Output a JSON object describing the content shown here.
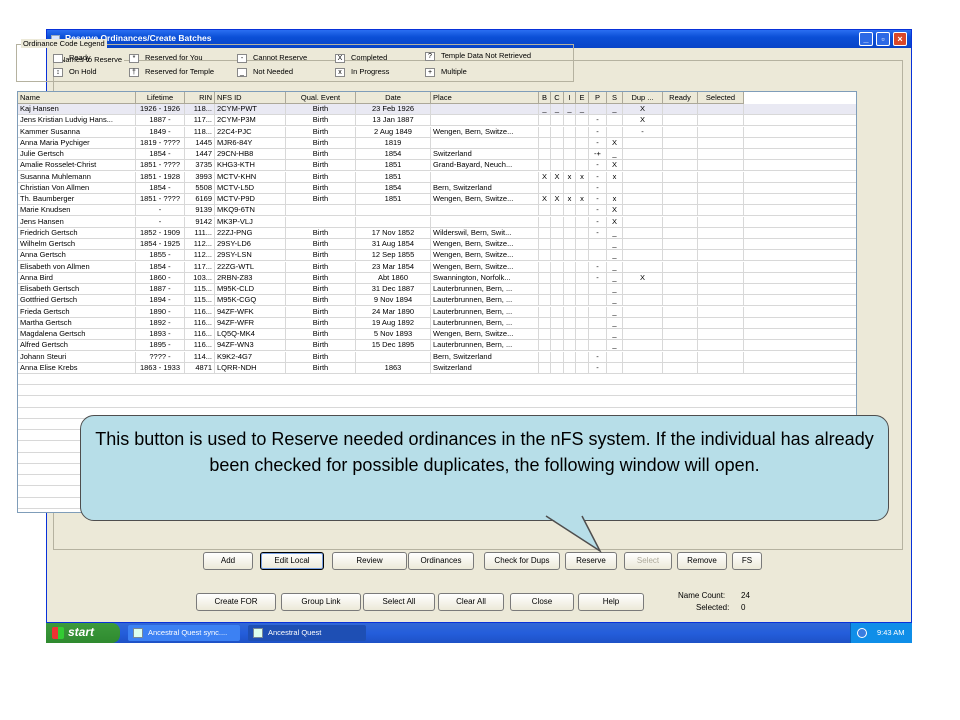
{
  "window": {
    "title": "Reserve Ordinances/Create Batches",
    "controls": [
      "_",
      "▫",
      "×"
    ]
  },
  "group_label": "Names to Reserve",
  "legend": {
    "title": "Ordinance Code Legend",
    "items": [
      {
        "symbol": "",
        "label": "Ready"
      },
      {
        "symbol": "↕",
        "label": "On Hold"
      },
      {
        "symbol": "*",
        "label": "Reserved for You"
      },
      {
        "symbol": "†",
        "label": "Reserved for Temple"
      },
      {
        "symbol": "-",
        "label": "Cannot Reserve"
      },
      {
        "symbol": "_",
        "label": "Not Needed"
      },
      {
        "symbol": "X",
        "label": "Completed"
      },
      {
        "symbol": "x",
        "label": "In Progress"
      },
      {
        "symbol": "?",
        "label": "Temple Data Not Retrieved"
      },
      {
        "symbol": "+",
        "label": "Multiple"
      }
    ]
  },
  "table": {
    "columns": [
      "Name",
      "Lifetime",
      "RIN",
      "NFS ID",
      "Qual. Event",
      "Date",
      "Place",
      "B",
      "C",
      "I",
      "E",
      "P",
      "S",
      "Dup ...",
      "Ready",
      "Selected"
    ],
    "rows": [
      [
        "Kaj Hansen",
        "1926 - 1926",
        "118...",
        "2CYM-PWT",
        "Birth",
        "23 Feb 1926",
        "",
        "_",
        "_",
        "_",
        "_",
        "",
        "_",
        "X",
        "",
        ""
      ],
      [
        "Jens Kristian Ludvig Hans...",
        "1887 -",
        "117...",
        "2CYM-P3M",
        "Birth",
        "13 Jan 1887",
        "",
        "",
        "",
        "",
        "",
        "-",
        "",
        "X",
        "",
        ""
      ],
      [
        "Kammer Susanna",
        "1849 -",
        "118...",
        "22C4-PJC",
        "Birth",
        "2 Aug 1849",
        "Wengen, Bern, Switze...",
        "",
        "",
        "",
        "",
        "-",
        "",
        "-",
        "",
        ""
      ],
      [
        "Anna Maria Pychiger",
        "1819 - ????",
        "1445",
        "MJR6-84Y",
        "Birth",
        "1819",
        "",
        "",
        "",
        "",
        "",
        "-",
        "X",
        "",
        "",
        ""
      ],
      [
        "Julie Gertsch",
        "1854 -",
        "1447",
        "29CN-HB8",
        "Birth",
        "1854",
        "Switzerland",
        "",
        "",
        "",
        "",
        "-+",
        "_",
        "",
        "",
        ""
      ],
      [
        "Amalie Rosselet-Christ",
        "1851 - ????",
        "3735",
        "KHG3-KTH",
        "Birth",
        "1851",
        "Grand-Bayard, Neuch...",
        "",
        "",
        "",
        "",
        "-",
        "X",
        "",
        "",
        ""
      ],
      [
        "Susanna Muhlemann",
        "1851 - 1928",
        "3993",
        "MCTV-KHN",
        "Birth",
        "1851",
        "",
        "X",
        "X",
        "x",
        "x",
        "-",
        "x",
        "",
        "",
        ""
      ],
      [
        "Christian Von Allmen",
        "1854 -",
        "5508",
        "MCTV-L5D",
        "Birth",
        "1854",
        "Bern, Switzerland",
        "",
        "",
        "",
        "",
        "-",
        "",
        "",
        "",
        ""
      ],
      [
        "Th. Baumberger",
        "1851 - ????",
        "6169",
        "MCTV-P9D",
        "Birth",
        "1851",
        "Wengen, Bern, Switze...",
        "X",
        "X",
        "x",
        "x",
        "-",
        "x",
        "",
        "",
        ""
      ],
      [
        "Marie Knudsen",
        "-",
        "9139",
        "MKQ9-6TN",
        "",
        "",
        "",
        "",
        "",
        "",
        "",
        "-",
        "X",
        "",
        "",
        ""
      ],
      [
        "Jens Hansen",
        "-",
        "9142",
        "MK3P-VLJ",
        "",
        "",
        "",
        "",
        "",
        "",
        "",
        "-",
        "X",
        "",
        "",
        ""
      ],
      [
        "Friedrich Gertsch",
        "1852 - 1909",
        "111...",
        "22ZJ-PNG",
        "Birth",
        "17 Nov 1852",
        "Wilderswil, Bern, Swit...",
        "",
        "",
        "",
        "",
        "-",
        "_",
        "",
        "",
        ""
      ],
      [
        "Wilhelm Gertsch",
        "1854 - 1925",
        "112...",
        "29SY-LD6",
        "Birth",
        "31 Aug 1854",
        "Wengen, Bern, Switze...",
        "",
        "",
        "",
        "",
        "",
        "_",
        "",
        "",
        ""
      ],
      [
        "Anna Gertsch",
        "1855 -",
        "112...",
        "29SY-LSN",
        "Birth",
        "12 Sep 1855",
        "Wengen, Bern, Switze...",
        "",
        "",
        "",
        "",
        "",
        "_",
        "",
        "",
        ""
      ],
      [
        "Elisabeth von Allmen",
        "1854 -",
        "117...",
        "22ZG-WTL",
        "Birth",
        "23 Mar 1854",
        "Wengen, Bern, Switze...",
        "",
        "",
        "",
        "",
        "-",
        "_",
        "",
        "",
        ""
      ],
      [
        "Anna Bird",
        "1860 -",
        "103...",
        "2RBN-Z83",
        "Birth",
        "Abt 1860",
        "Swannington, Norfolk...",
        "",
        "",
        "",
        "",
        "-",
        "_",
        "X",
        "",
        ""
      ],
      [
        "Elisabeth Gertsch",
        "1887 -",
        "115...",
        "M95K-CLD",
        "Birth",
        "31 Dec 1887",
        "Lauterbrunnen, Bern, ...",
        "",
        "",
        "",
        "",
        "",
        "_",
        "",
        "",
        ""
      ],
      [
        "Gottfried Gertsch",
        "1894 -",
        "115...",
        "M95K-CGQ",
        "Birth",
        "9 Nov 1894",
        "Lauterbrunnen, Bern, ...",
        "",
        "",
        "",
        "",
        "",
        "_",
        "",
        "",
        ""
      ],
      [
        "Frieda Gertsch",
        "1890 -",
        "116...",
        "94ZF-WFK",
        "Birth",
        "24 Mar 1890",
        "Lauterbrunnen, Bern, ...",
        "",
        "",
        "",
        "",
        "",
        "_",
        "",
        "",
        ""
      ],
      [
        "Martha Gertsch",
        "1892 -",
        "116...",
        "94ZF-WFR",
        "Birth",
        "19 Aug 1892",
        "Lauterbrunnen, Bern, ...",
        "",
        "",
        "",
        "",
        "",
        "_",
        "",
        "",
        ""
      ],
      [
        "Magdalena Gertsch",
        "1893 -",
        "116...",
        "LQ5Q-MK4",
        "Birth",
        "5 Nov 1893",
        "Wengen, Bern, Switze...",
        "",
        "",
        "",
        "",
        "",
        "_",
        "",
        "",
        ""
      ],
      [
        "Alfred Gertsch",
        "1895 -",
        "116...",
        "94ZF-WN3",
        "Birth",
        "15 Dec 1895",
        "Lauterbrunnen, Bern, ...",
        "",
        "",
        "",
        "",
        "",
        "_",
        "",
        "",
        ""
      ],
      [
        "Johann Steuri",
        "???? -",
        "114...",
        "K9K2-4G7",
        "Birth",
        "",
        "Bern, Switzerland",
        "",
        "",
        "",
        "",
        "-",
        "",
        "",
        "",
        ""
      ],
      [
        "Anna Elise Krebs",
        "1863 - 1933",
        "4871",
        "LQRR-NDH",
        "Birth",
        "1863",
        "Switzerland",
        "",
        "",
        "",
        "",
        "-",
        "",
        "",
        "",
        ""
      ]
    ]
  },
  "callout": {
    "text": "This button is used to Reserve needed ordinances in the nFS system.  If the individual has already been checked for possible duplicates, the following window will open."
  },
  "buttons_row1": [
    "Add",
    "Edit Local",
    "Review",
    "Ordinances",
    "Check for Dups",
    "Reserve",
    "Select",
    "Remove",
    "FS"
  ],
  "buttons_row2": [
    "Create FOR",
    "Group Link",
    "Select All",
    "Clear All",
    "Close",
    "Help"
  ],
  "counts": {
    "name_count_label": "Name Count:",
    "name_count": "24",
    "selected_label": "Selected:",
    "selected": "0"
  },
  "taskbar": {
    "start": "start",
    "tasks": [
      "Ancestral Quest sync....",
      "Ancestral Quest"
    ],
    "time": "9:43 AM"
  },
  "colors": {
    "title": "#0b4fd6",
    "callout": "#b7dee8",
    "taskbar": "#245edb",
    "start": "#2f8a2f"
  }
}
